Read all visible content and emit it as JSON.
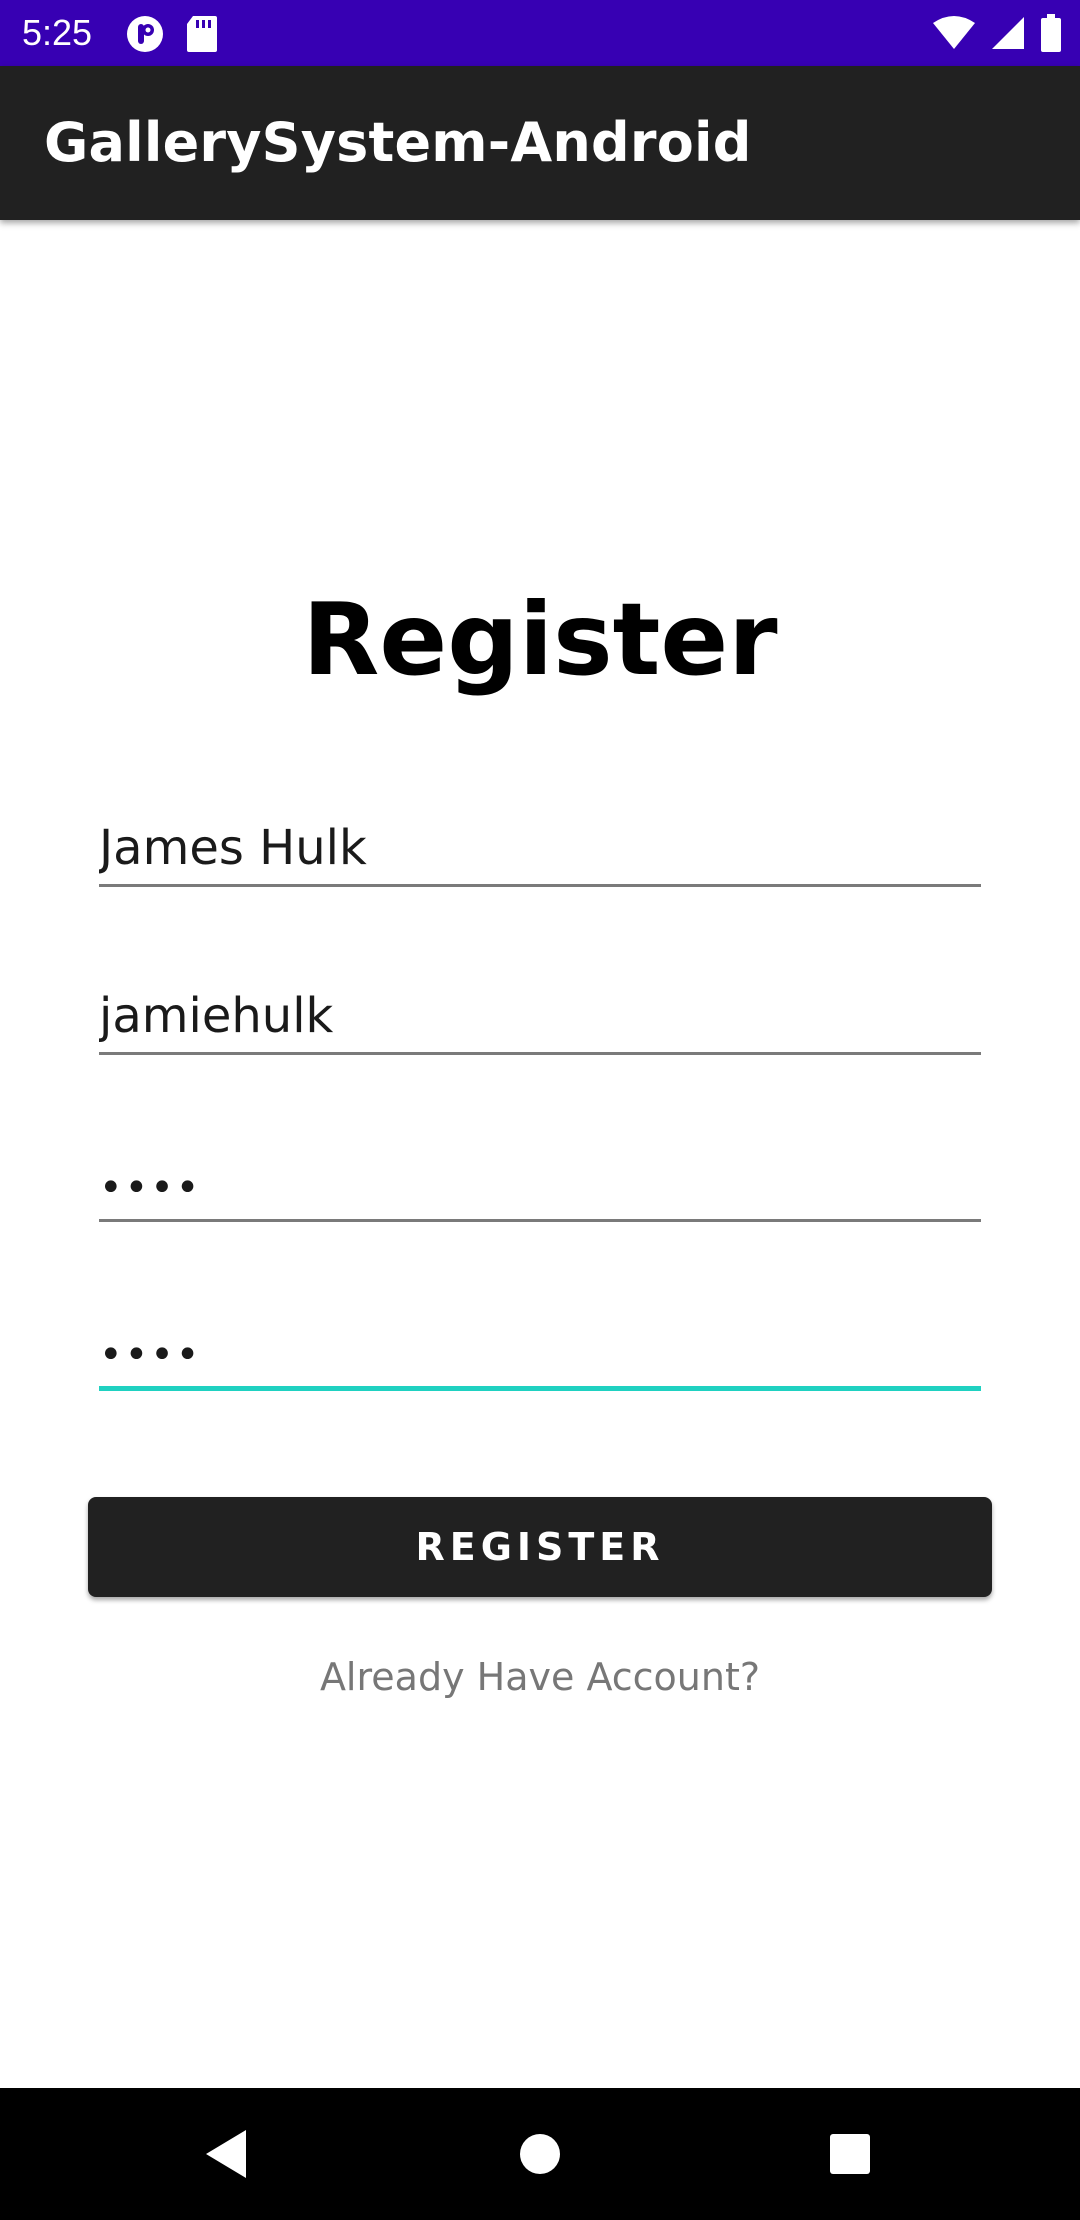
{
  "status_bar": {
    "time": "5:25",
    "left_icons": [
      "p-badge-icon",
      "sd-card-icon"
    ],
    "right_icons": [
      "wifi-icon",
      "cell-signal-icon",
      "battery-icon"
    ],
    "background": "#3700b3"
  },
  "app_bar": {
    "title": "GallerySystem-Android",
    "background": "#212121"
  },
  "form": {
    "title": "Register",
    "fields": [
      {
        "name": "full-name",
        "value": "James Hulk"
      },
      {
        "name": "username",
        "value": "jamiehulk"
      },
      {
        "name": "password",
        "value": "••••"
      },
      {
        "name": "confirm-password",
        "value": "••••"
      }
    ],
    "focused_field_color": "#1fd1c1",
    "submit_label": "REGISTER",
    "login_link": "Already Have Account?"
  },
  "nav_bar": {
    "buttons": [
      "back-icon",
      "home-icon",
      "recents-icon"
    ]
  }
}
